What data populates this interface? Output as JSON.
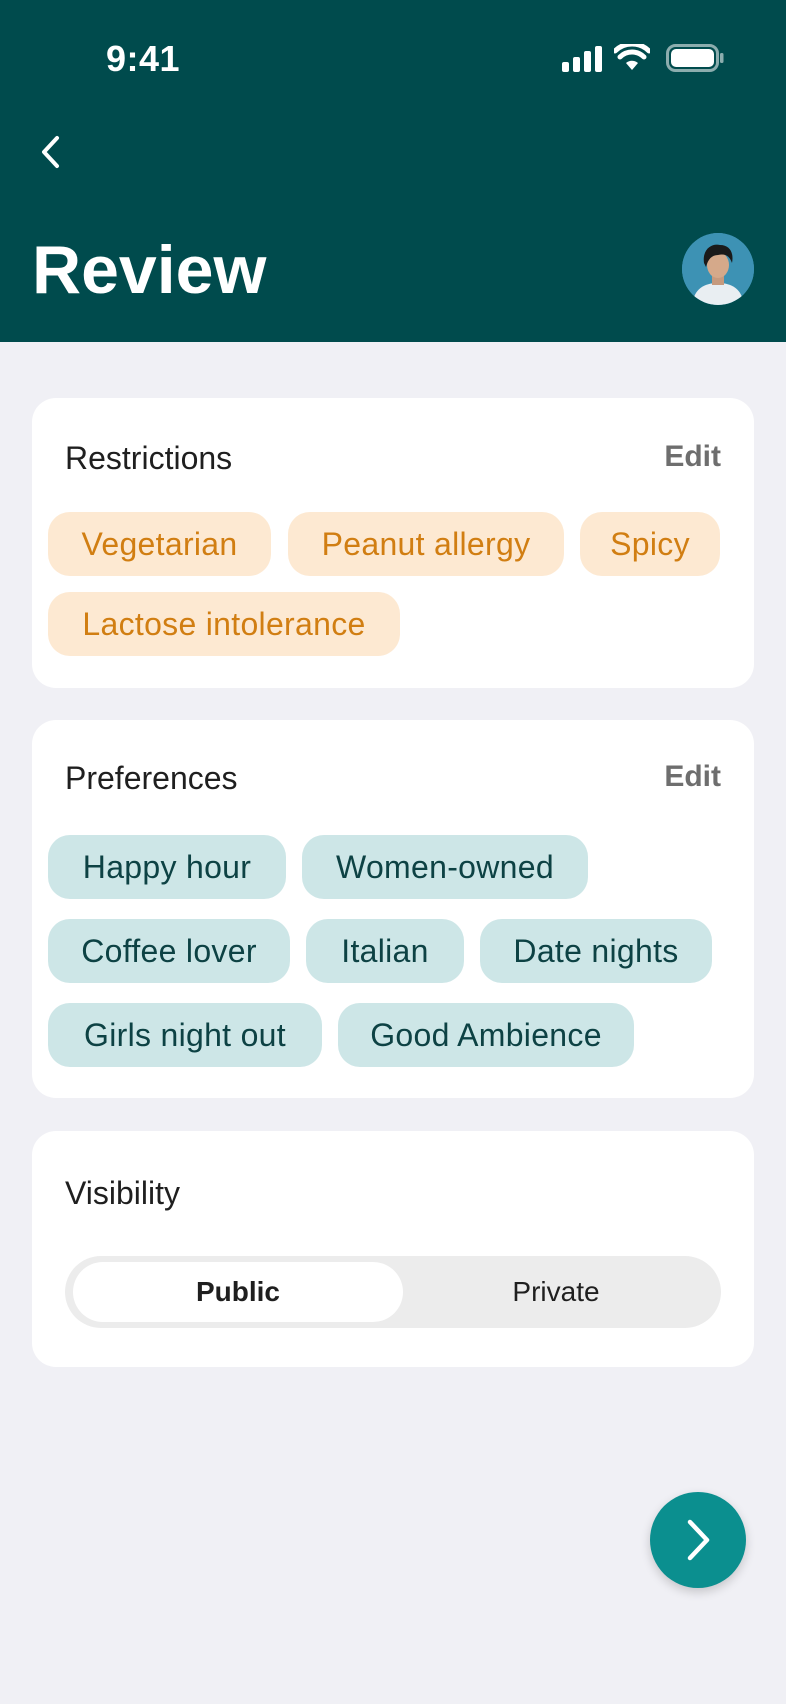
{
  "status_bar": {
    "time": "9:41"
  },
  "header": {
    "title": "Review"
  },
  "restrictions": {
    "title": "Restrictions",
    "edit_label": "Edit",
    "chips": [
      "Vegetarian",
      "Peanut allergy",
      "Spicy",
      "Lactose intolerance"
    ]
  },
  "preferences": {
    "title": "Preferences",
    "edit_label": "Edit",
    "chips": [
      "Happy hour",
      "Women-owned",
      "Coffee lover",
      "Italian",
      "Date nights",
      "Girls night out",
      "Good Ambience"
    ]
  },
  "visibility": {
    "title": "Visibility",
    "options": [
      "Public",
      "Private"
    ],
    "selected": "Public"
  },
  "colors": {
    "header_bg": "#004b4d",
    "page_bg": "#f0f0f5",
    "restriction_chip_bg": "#fde9d2",
    "restriction_chip_text": "#d17e12",
    "preference_chip_bg": "#cde6e7",
    "preference_chip_text": "#0d4244",
    "fab_bg": "#0b8f8f"
  },
  "icons": {
    "back": "chevron-left-icon",
    "next": "chevron-right-icon",
    "signal": "cellular-signal-icon",
    "wifi": "wifi-icon",
    "battery": "battery-icon"
  }
}
